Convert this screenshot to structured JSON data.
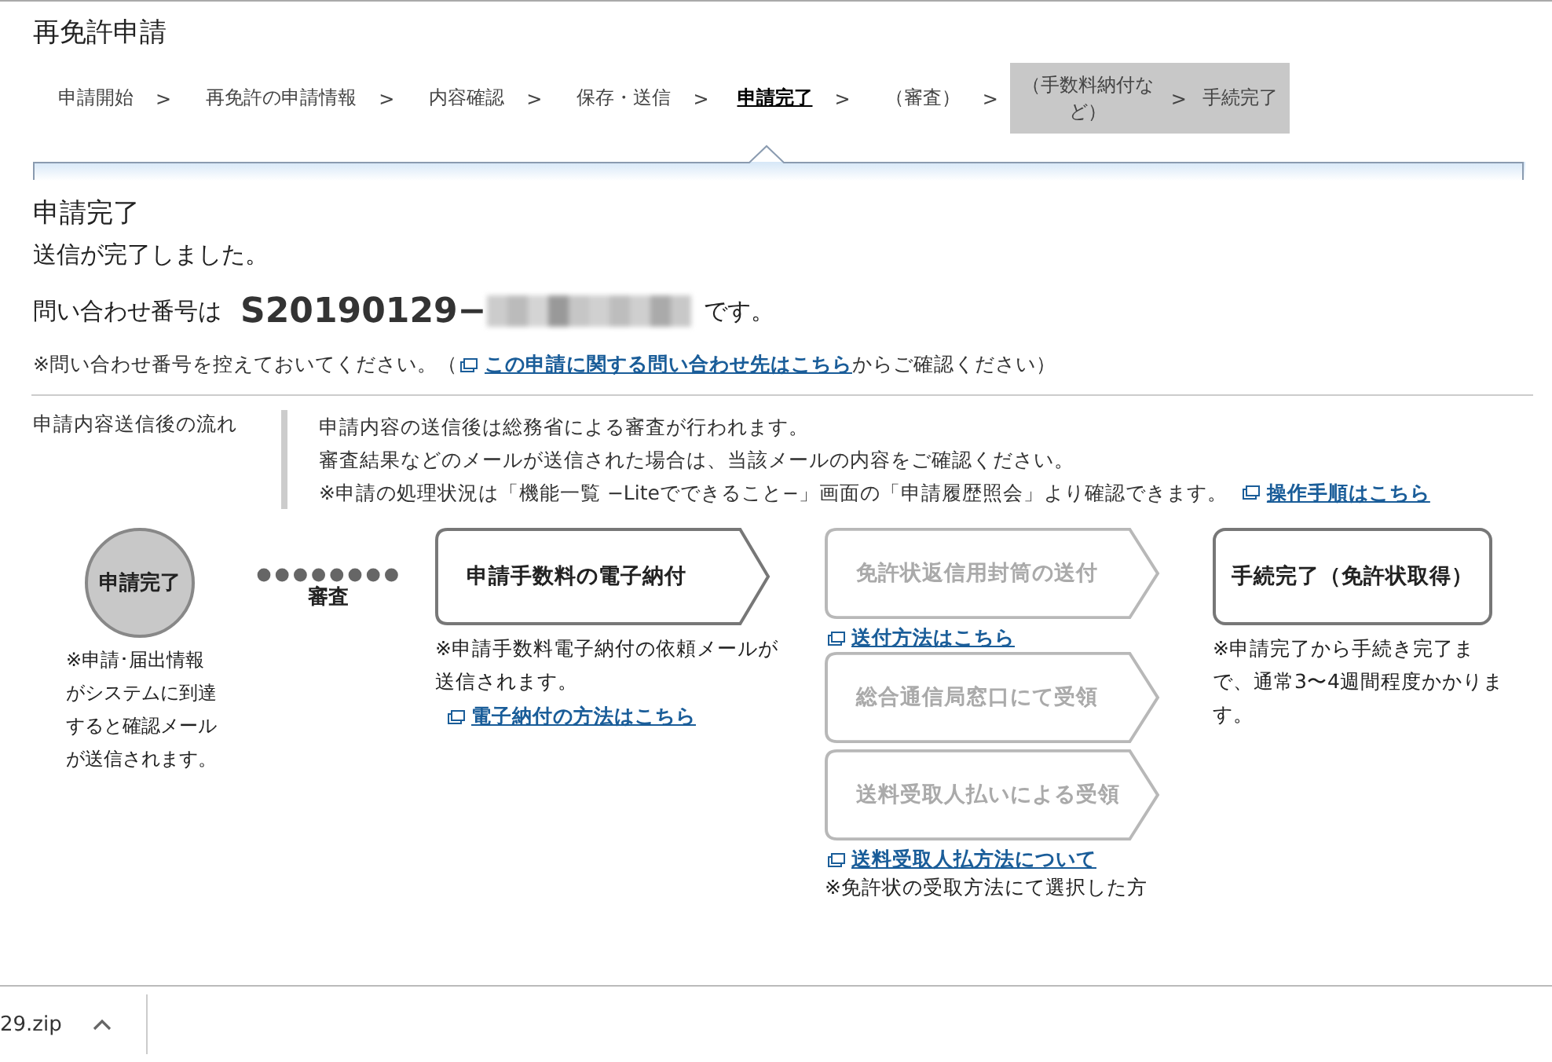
{
  "page_title": "再免許申請",
  "steps": [
    {
      "label": "申請開始",
      "selected": false,
      "shaded": false
    },
    {
      "label": "再免許の申請情報",
      "selected": false,
      "shaded": false
    },
    {
      "label": "内容確認",
      "selected": false,
      "shaded": false
    },
    {
      "label": "保存・送信",
      "selected": false,
      "shaded": false
    },
    {
      "label": "申請完了",
      "selected": true,
      "shaded": false
    },
    {
      "label": "（審査）",
      "selected": false,
      "shaded": false
    },
    {
      "label": "（手数料納付など）",
      "selected": false,
      "shaded": true
    },
    {
      "label": "手続完了",
      "selected": false,
      "shaded": true
    }
  ],
  "separator": ">",
  "heading": "申請完了",
  "sent_message": "送信が完了しました。",
  "inquiry": {
    "prefix": "問い合わせ番号は",
    "number": "S20190129−",
    "suffix": "です。"
  },
  "notice": {
    "before": "※問い合わせ番号を控えておいてください。（",
    "link": "この申請に関する問い合わせ先はこちら",
    "after": "からご確認ください）"
  },
  "flow_section": {
    "label": "申請内容送信後の流れ",
    "lines": [
      "申請内容の送信後は総務省による審査が行われます。",
      "審査結果などのメールが送信された場合は、当該メールの内容をご確認ください。",
      "※申請の処理状況は「機能一覧 −Liteでできること−」画面の「申請履歴照会」より確認できます。"
    ],
    "link": "操作手順はこちら"
  },
  "flow": [
    {
      "kind": "circle",
      "label": "申請完了",
      "note": "※申請･届出情報がシステムに到達すると確認メールが送信されます。"
    },
    {
      "kind": "dots",
      "label": "審査"
    },
    {
      "kind": "arrow",
      "label": "申請手数料の電子納付",
      "disabled": false,
      "note": "※申請手数料電子納付の依頼メールが送信されます。",
      "link": "電子納付の方法はこちら"
    },
    {
      "kind": "column",
      "items": [
        {
          "kind": "arrow",
          "label": "免許状返信用封筒の送付",
          "disabled": true
        },
        {
          "kind": "link",
          "text": "送付方法はこちら"
        },
        {
          "kind": "arrow",
          "label": "総合通信局窓口にて受領",
          "disabled": true
        },
        {
          "kind": "arrow",
          "label": "送料受取人払いによる受領",
          "disabled": true
        },
        {
          "kind": "link",
          "text": "送料受取人払方法について"
        },
        {
          "kind": "note",
          "text": "※免許状の受取方法にて選択した方"
        }
      ]
    },
    {
      "kind": "box",
      "label": "手続完了（免許状取得）",
      "note": "※申請完了から手続き完了まで、通常3〜4週間程度かかります。"
    }
  ],
  "download_bar": {
    "file": "29.zip"
  }
}
